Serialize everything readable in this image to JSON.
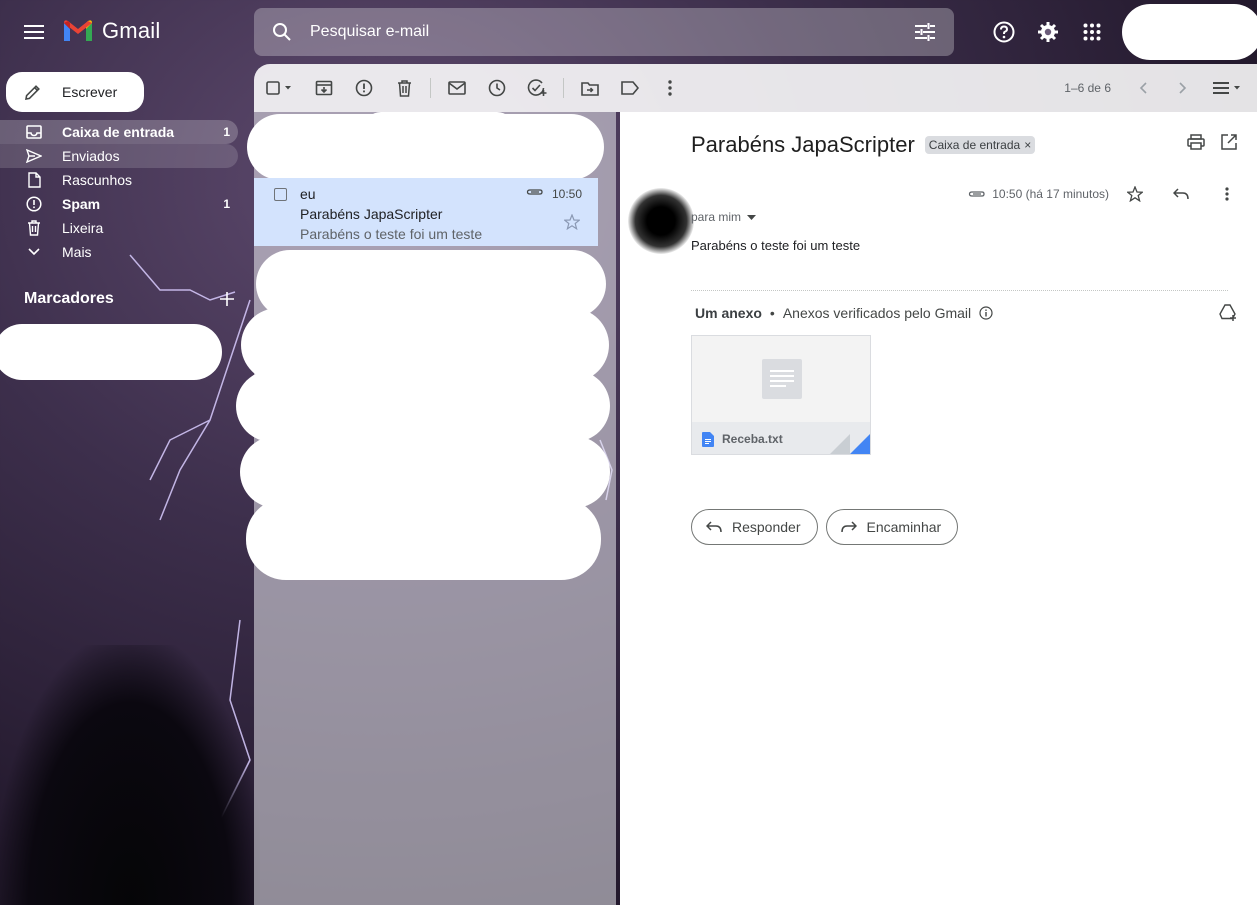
{
  "app": {
    "name": "Gmail"
  },
  "search": {
    "placeholder": "Pesquisar e-mail"
  },
  "compose": {
    "label": "Escrever"
  },
  "nav": {
    "items": [
      {
        "label": "Caixa de entrada",
        "count": "1"
      },
      {
        "label": "Enviados",
        "count": ""
      },
      {
        "label": "Rascunhos",
        "count": ""
      },
      {
        "label": "Spam",
        "count": "1"
      },
      {
        "label": "Lixeira",
        "count": ""
      },
      {
        "label": "Mais",
        "count": ""
      }
    ]
  },
  "labels": {
    "title": "Marcadores"
  },
  "toolbar": {
    "pager": "1–6 de 6"
  },
  "list": {
    "selected": {
      "from": "eu",
      "subject": "Parabéns JapaScripter",
      "snippet": "Parabéns o teste foi um teste",
      "time": "10:50"
    }
  },
  "message": {
    "subject": "Parabéns JapaScripter",
    "label_chip": "Caixa de entrada",
    "chip_close": "×",
    "time": "10:50 (há 17 minutos)",
    "to": "para mim",
    "body": "Parabéns o teste foi um teste",
    "attachments_title": "Um anexo",
    "attachments_sep": "•",
    "attachments_verified": "Anexos verificados pelo Gmail",
    "attachment_name": "Receba.txt",
    "reply_label": "Responder",
    "forward_label": "Encaminhar"
  },
  "colors": {
    "accent_blue": "#4285f4",
    "selected_row": "#d3e3fd"
  }
}
